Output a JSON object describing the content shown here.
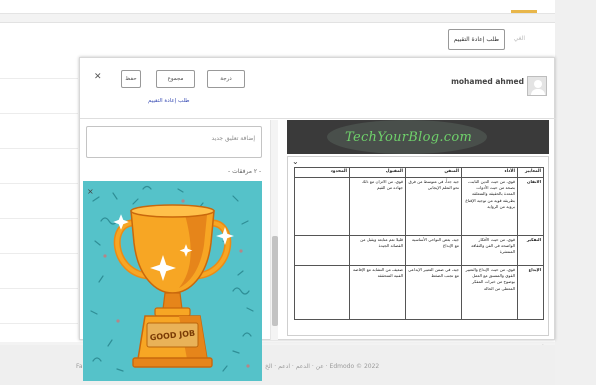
{
  "page": {
    "reassess_button": "طلب إعادة التقييم",
    "cancel_link": "الغي",
    "footer_prefix": "Fa",
    "footer_copyright": "Edmodo © 2022 · عن · الدعم · ادعم · الخ"
  },
  "modal": {
    "author_name": "mohamed ahmed",
    "grade_button": "درجة",
    "total_button": "مجموع",
    "save_button": "حفظ",
    "reassess_link": "طلب إعادة التقييم",
    "comment_placeholder": "إضافة تعليق جديد",
    "attachments_label": "- ٢ مرفقات -"
  },
  "document": {
    "watermark": "TechYourBlog.com",
    "rubric": {
      "headers": [
        "المعايير",
        "الأداء",
        "المتقن",
        "المقبول",
        "المحدود"
      ],
      "rows": [
        {
          "criterion": "الاتقان",
          "cells": [
            "قوي، من حيث الدين الثابت، بصحة من حيث الأدوات المعدة بالحقيقة والمتعلقة بطريقة قوية من توجيه الإقناع بروية من الرواية",
            "جيد جداً، في متوسط من فرق نحو التعلم الإيجابي",
            "قوي، من الاتزان مع ذلك جهاده من القيم"
          ]
        },
        {
          "criterion": "التفكير",
          "cells": [
            "قوي، من حيث الأفكار الواضحة في الفن والثقافة المنتشرة",
            "جيد، بعض النواحي الأساسية مع الإبداع",
            "قليلا نعم متابعة ويقبل من القصائد الجيدة"
          ]
        },
        {
          "criterion": "الإبداع",
          "cells": [
            "قوي، من حيث الإبداع والتعبير القوي والمتسق مع العمل بوضوح من خبرات المفكر المعطى من الحالة",
            "جيد، في ضمن التعبير الإبداعي مع تجنب الضغط",
            "ضعيف من التشابه مع الإفاضة الفنية المتحققة"
          ]
        }
      ]
    }
  },
  "sticker": {
    "plaque_text": "GOOD JOB"
  }
}
